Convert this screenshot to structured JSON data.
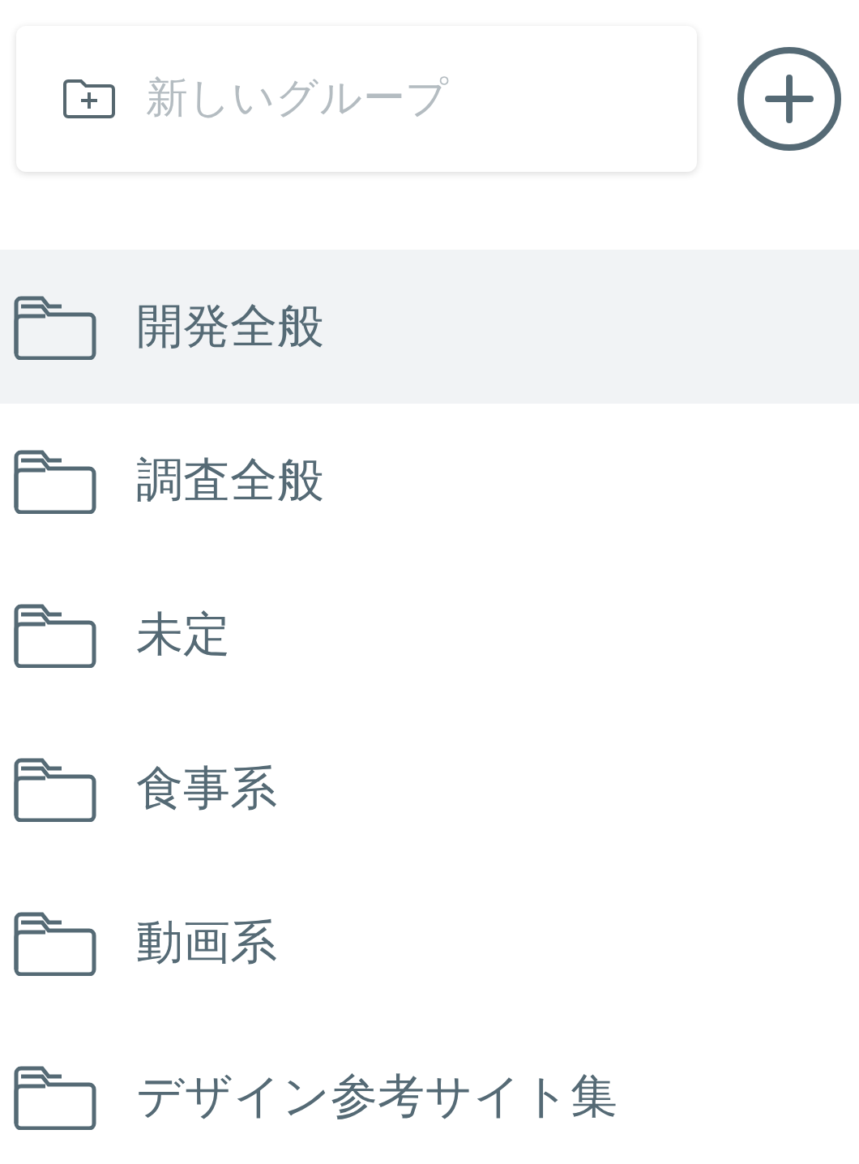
{
  "new_group": {
    "placeholder": "新しいグループ"
  },
  "groups": [
    {
      "label": "開発全般",
      "selected": true
    },
    {
      "label": "調査全般",
      "selected": false
    },
    {
      "label": "未定",
      "selected": false
    },
    {
      "label": "食事系",
      "selected": false
    },
    {
      "label": "動画系",
      "selected": false
    },
    {
      "label": "デザイン参考サイト集",
      "selected": false
    }
  ]
}
